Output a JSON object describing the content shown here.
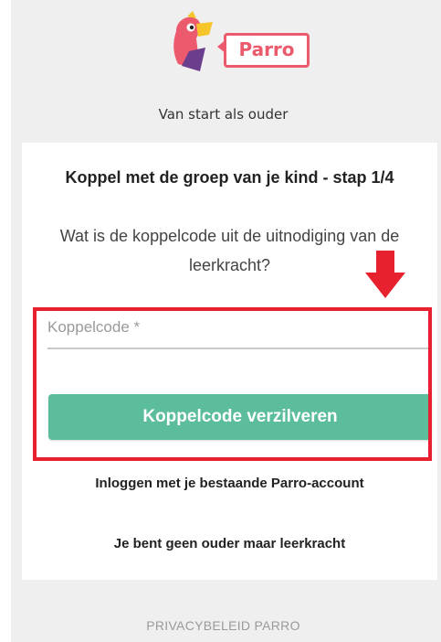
{
  "brand": {
    "wordmark": "Parro",
    "accent_color": "#ec5a6d"
  },
  "header": {
    "subtitle": "Van start als ouder"
  },
  "card": {
    "title": "Koppel met de groep van je kind - stap 1/4",
    "question": "Wat is de koppelcode uit de uitnodiging van de leerkracht?",
    "input": {
      "value": "",
      "placeholder": "Koppelcode *"
    },
    "redeem_button_label": "Koppelcode verzilveren",
    "button_color": "#5bbd9c",
    "login_link": "Inloggen met je bestaande Parro-account",
    "teacher_link": "Je bent geen ouder maar leerkracht"
  },
  "annotation": {
    "highlight_color": "#e8212e",
    "arrow_icon": "arrow-down-icon"
  },
  "footer": {
    "privacy_link": "PRIVACYBELEID PARRO"
  }
}
